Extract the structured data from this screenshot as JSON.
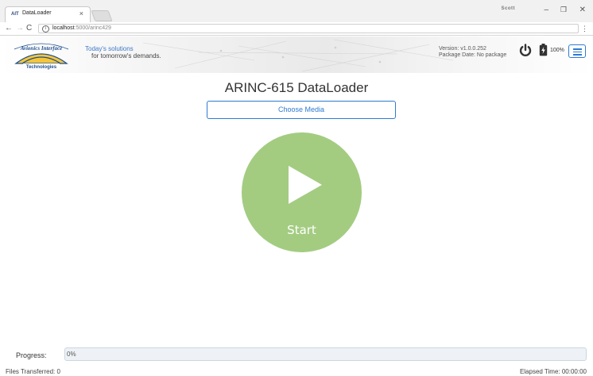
{
  "browser": {
    "tab_title": "DataLoader",
    "tab_favicon": "AIT",
    "tab_close": "×",
    "user_badge": "Scott",
    "window_minimize": "–",
    "window_maximize": "❐",
    "window_close": "✕",
    "nav_back": "←",
    "nav_forward": "→",
    "nav_reload": "C",
    "url_host": "localhost",
    "url_path": ":5000/arinc429",
    "menu": "⋮"
  },
  "header": {
    "logo": {
      "line1": "Avionics Interface",
      "line2": "Technologies"
    },
    "tagline_line1": "Today's solutions",
    "tagline_line2": "for tomorrow's demands.",
    "version": "Version: v1.0.0.252",
    "package_date": "Package Date: No package",
    "battery_percent": "100%",
    "icons": [
      "power-icon",
      "battery-icon",
      "hamburger-menu-icon"
    ]
  },
  "main": {
    "title": "ARINC-615 DataLoader",
    "choose_media_label": "Choose Media",
    "start_label": "Start"
  },
  "footer": {
    "progress_label": "Progress:",
    "progress_text": "0%",
    "progress_value": 0,
    "files_transferred": "Files Transferred: 0",
    "elapsed_time": "Elapsed Time: 00:00:00"
  },
  "colors": {
    "accent": "#2e7bd1",
    "start_button": "#a3cc81",
    "tagline_blue": "#3c78c8"
  }
}
